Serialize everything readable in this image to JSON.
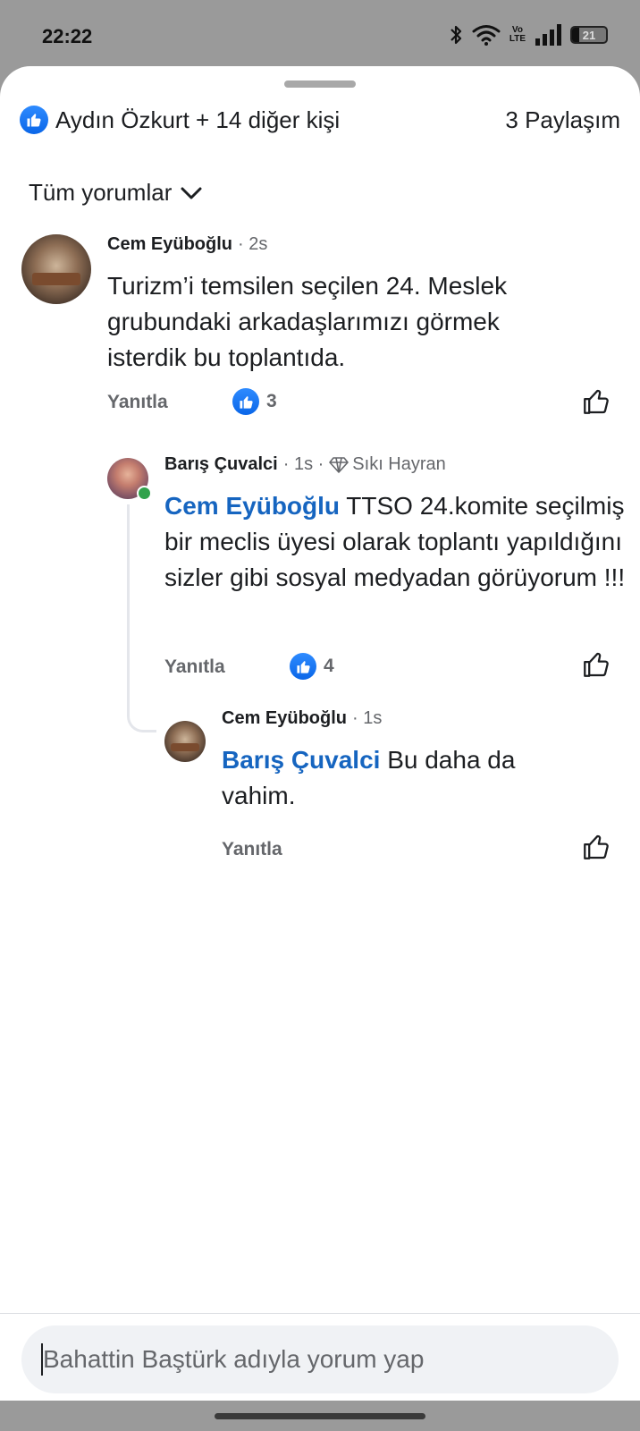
{
  "status_bar": {
    "time": "22:22",
    "network_label": "Vo\nLTE",
    "battery": "21",
    "icons": [
      "bluetooth-icon",
      "wifi-icon",
      "volte-icon",
      "signal-icon",
      "battery-icon"
    ]
  },
  "header": {
    "reactors": "Aydın Özkurt + 14 diğer kişi",
    "shares": "3 Paylaşım"
  },
  "filter": {
    "label": "Tüm yorumlar"
  },
  "comments": [
    {
      "author": "Cem Eyüboğlu",
      "time": "· 2s",
      "text": "Turizm’i temsilen seçilen 24. Meslek grubundaki arkadaşlarımızı görmek isterdik bu toplantıda.",
      "reply_label": "Yanıtla",
      "like_count": "3"
    },
    {
      "author": "Barış Çuvalci",
      "time": "· 1s ·",
      "badge": "Sıkı Hayran",
      "mention": "Cem Eyüboğlu",
      "text": " TTSO 24.komite seçilmiş bir meclis üyesi olarak toplantı yapıldığını sizler gibi sosyal medyadan görüyorum !!!",
      "reply_label": "Yanıtla",
      "like_count": "4"
    },
    {
      "author": "Cem Eyüboğlu",
      "time": "· 1s",
      "mention": "Barış Çuvalci",
      "text": " Bu daha da vahim.",
      "reply_label": "Yanıtla"
    }
  ],
  "composer": {
    "placeholder": "Bahattin Baştürk adıyla yorum yap"
  },
  "colors": {
    "accent": "#1665c0",
    "like_blue": "#0a66e8",
    "muted": "#65676b"
  }
}
